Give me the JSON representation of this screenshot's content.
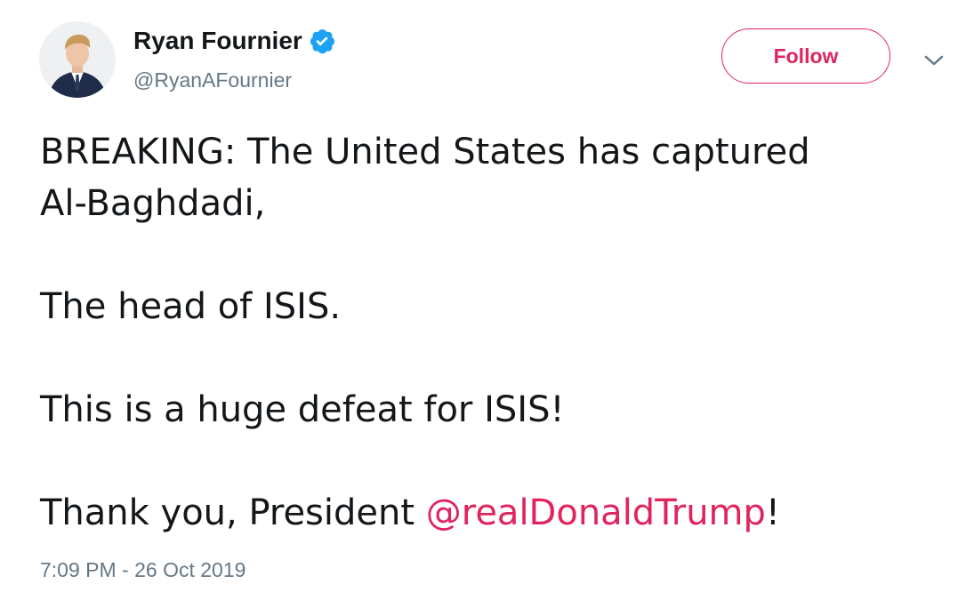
{
  "author": {
    "display_name": "Ryan Fournier",
    "handle": "@RyanAFournier",
    "verified": true,
    "avatar_icon": "avatar-photo"
  },
  "actions": {
    "follow_label": "Follow",
    "menu_icon": "chevron-down-icon"
  },
  "tweet": {
    "line1": "BREAKING: The United States has captured",
    "line2": "Al-Baghdadi,",
    "line3": "The head of ISIS.",
    "line4": "This is a huge defeat for ISIS!",
    "line5_prefix": "Thank you, President ",
    "line5_mention": "@realDonaldTrump",
    "line5_suffix": "!",
    "timestamp": "7:09 PM - 26 Oct 2019"
  },
  "colors": {
    "accent": "#e0245e",
    "verified_blue": "#1da1f2",
    "text": "#14171a",
    "muted": "#657786"
  }
}
